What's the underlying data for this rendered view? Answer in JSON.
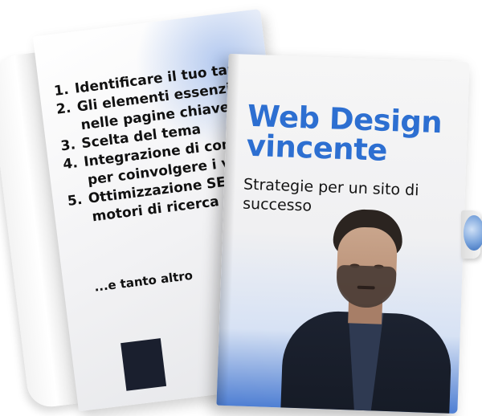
{
  "back_booklet": {
    "toc": [
      {
        "num": "1.",
        "text": "Identificare il tuo target"
      },
      {
        "num": "2.",
        "text": "Gli elementi essenziali",
        "cont": "nelle pagine chiave"
      },
      {
        "num": "3.",
        "text": "Scelta del tema"
      },
      {
        "num": "4.",
        "text": "Integrazione di cont",
        "cont": "per coinvolgere i vi"
      },
      {
        "num": "5.",
        "text": "Ottimizzazione SE",
        "cont": "motori di ricerca"
      }
    ],
    "extra": "...e tanto altro"
  },
  "cover": {
    "title_line1": "Web Design",
    "title_line2": "vincente",
    "subtitle": "Strategie per un sito di successo"
  },
  "colors": {
    "title_blue": "#2d6fd1",
    "cover_gradient_blue": "#4f7fd3",
    "text_dark": "#111111"
  }
}
